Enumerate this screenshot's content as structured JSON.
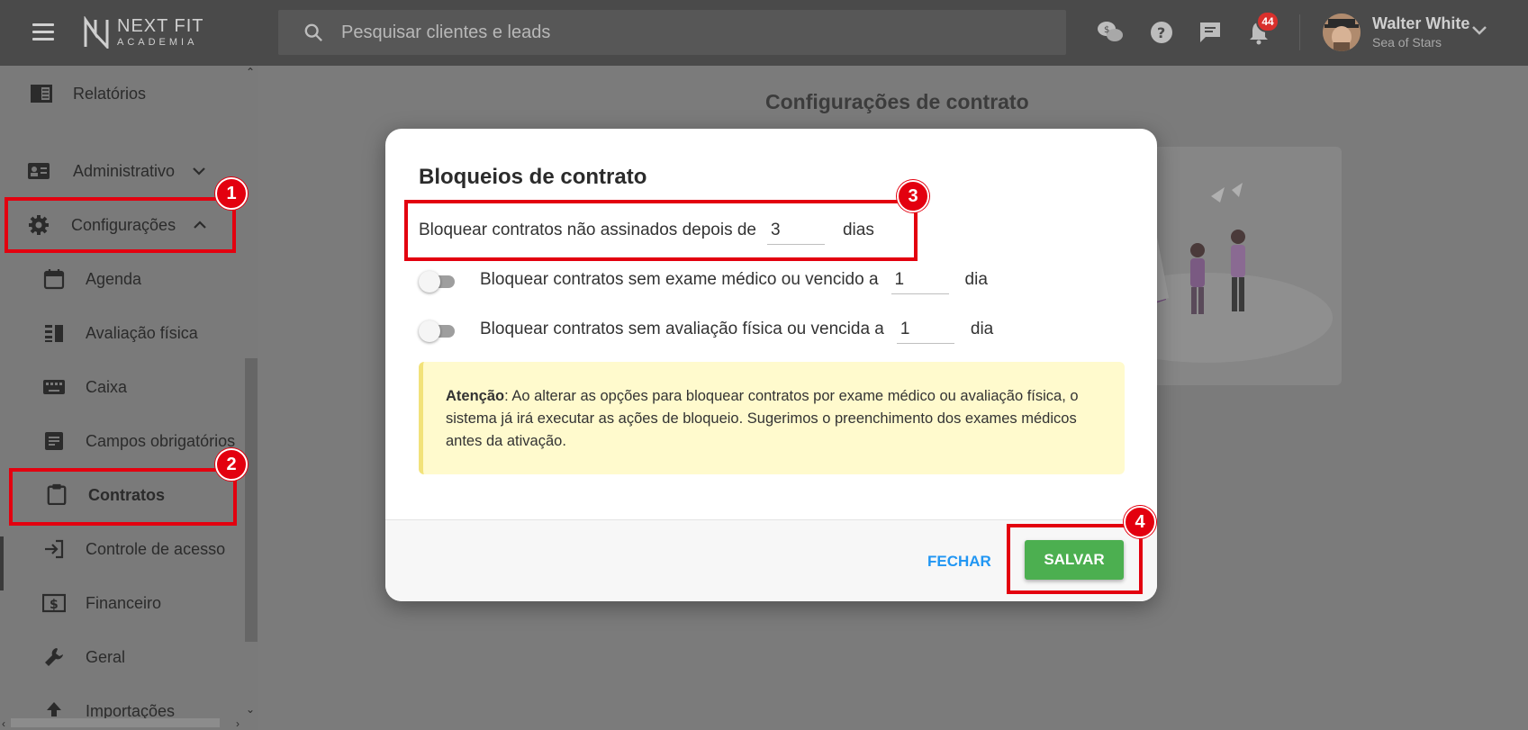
{
  "app": {
    "logo_line1": "NEXT FIT",
    "logo_line2": "ACADEMIA"
  },
  "search": {
    "placeholder": "Pesquisar clientes e leads"
  },
  "topbar": {
    "notifications_count": "44",
    "user_name": "Walter White",
    "user_org": "Sea of Stars",
    "icons": [
      "whatsapp-money-icon",
      "help-icon",
      "chat-icon",
      "bell-icon",
      "chevron-down-icon"
    ]
  },
  "sidebar": {
    "items": [
      {
        "label": "Relatórios",
        "icon": "report-icon"
      },
      {
        "label": "Administrativo",
        "icon": "id-card-icon"
      },
      {
        "label": "Configurações",
        "icon": "gear-icon"
      },
      {
        "label": "Agenda",
        "icon": "calendar-icon"
      },
      {
        "label": "Avaliação física",
        "icon": "assessment-icon"
      },
      {
        "label": "Caixa",
        "icon": "keyboard-icon"
      },
      {
        "label": "Campos obrigatórios",
        "icon": "form-icon"
      },
      {
        "label": "Contratos",
        "icon": "clipboard-icon"
      },
      {
        "label": "Controle de acesso",
        "icon": "login-icon"
      },
      {
        "label": "Financeiro",
        "icon": "dollar-icon"
      },
      {
        "label": "Geral",
        "icon": "wrench-icon"
      },
      {
        "label": "Importações",
        "icon": "upload-icon"
      }
    ]
  },
  "main": {
    "page_title": "Configurações de contrato"
  },
  "modal": {
    "title": "Bloqueios de contrato",
    "unsigned_label": "Bloquear contratos não assinados depois de",
    "unsigned_value": "3",
    "unsigned_unit": "dias",
    "exam_label": "Bloquear contratos sem exame médico ou vencido a",
    "exam_value": "1",
    "exam_unit": "dia",
    "exam_enabled": false,
    "assessment_label": "Bloquear contratos sem avaliação física ou vencida a",
    "assessment_value": "1",
    "assessment_unit": "dia",
    "assessment_enabled": false,
    "note_title": "Atenção",
    "note_text": ": Ao alterar as opções para bloquear contratos por exame médico ou avaliação física, o sistema já irá executar as ações de bloqueio. Sugerimos o preenchimento dos exames médicos antes da ativação.",
    "close_label": "FECHAR",
    "save_label": "SALVAR"
  },
  "annotations": {
    "steps": [
      "1",
      "2",
      "3",
      "4"
    ]
  },
  "colors": {
    "accent_red": "#e3000f",
    "save_green": "#4caf50",
    "close_blue": "#2196f3",
    "note_bg": "#fffacd"
  }
}
